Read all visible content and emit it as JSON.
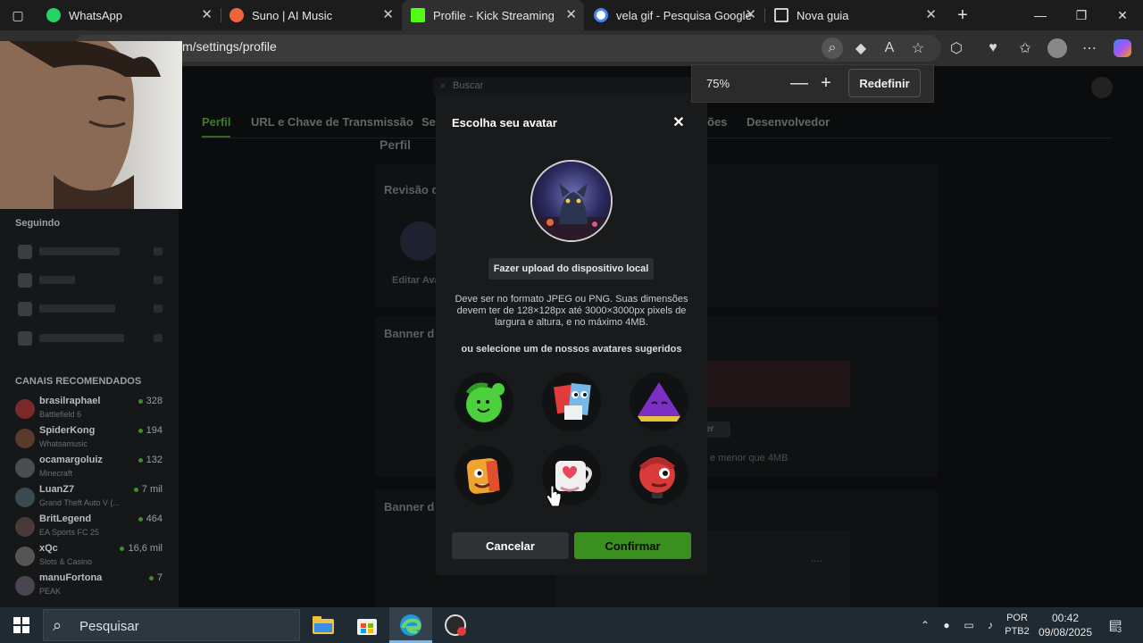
{
  "tabs": [
    {
      "title": "WhatsApp",
      "favicon": "whatsapp-icon",
      "color": "#25d366"
    },
    {
      "title": "Suno | AI Music",
      "favicon": "suno-icon",
      "color": "#f0643c"
    },
    {
      "title": "Profile - Kick Streaming",
      "favicon": "kick-icon",
      "color": "#53fc18",
      "active": true
    },
    {
      "title": "vela gif - Pesquisa Google",
      "favicon": "google-icon",
      "color": "#4285f4"
    },
    {
      "title": "Nova guia",
      "favicon": "new-tab-icon",
      "color": "#cccccc"
    }
  ],
  "address_bar": {
    "url": "m/settings/profile"
  },
  "zoom": {
    "value": "75%",
    "reset_label": "Redefinir"
  },
  "page": {
    "search_placeholder": "Buscar",
    "nav_tabs": [
      "Perfil",
      "URL e Chave de Transmissão",
      "Se",
      "ões",
      "Desenvolvedor"
    ],
    "section_title": "Perfil",
    "revision_label": "Revisão d",
    "edit_label": "Editar Ava",
    "banner_label_1": "Banner d",
    "banner_label_2": "Banner d",
    "banner_hint": "e menor que 4MB",
    "banner_btn": "er"
  },
  "sidebar": {
    "following_header": "Seguindo",
    "recommended_header": "CANAIS RECOMENDADOS",
    "recommended": [
      {
        "name": "brasilraphael",
        "game": "Battlefield 6",
        "viewers": "328"
      },
      {
        "name": "SpiderKong",
        "game": "Whatsamusic",
        "viewers": "194"
      },
      {
        "name": "ocamargoluiz",
        "game": "Minecraft",
        "viewers": "132"
      },
      {
        "name": "LuanZ7",
        "game": "Grand Theft Auto V (...",
        "viewers": "7 mil"
      },
      {
        "name": "BritLegend",
        "game": "EA Sports FC 25",
        "viewers": "464"
      },
      {
        "name": "xQc",
        "game": "Slots & Casino",
        "viewers": "16,6 mil"
      },
      {
        "name": "manuFortona",
        "game": "PEAK",
        "viewers": "7"
      }
    ]
  },
  "modal": {
    "title": "Escolha seu avatar",
    "upload_label": "Fazer upload do dispositivo local",
    "hint": "Deve ser no formato JPEG ou PNG. Suas dimensões devem ter de 128×128px até 3000×3000px pixels de largura e altura, e no máximo 4MB.",
    "suggest_label": "ou selecione um de nossos avatares sugeridos",
    "avatars": [
      "green-blob-avatar",
      "blue-red-block-avatar",
      "purple-triangle-avatar",
      "orange-face-avatar",
      "heart-mug-avatar",
      "red-ball-avatar"
    ],
    "cancel_label": "Cancelar",
    "confirm_label": "Confirmar"
  },
  "taskbar": {
    "search_placeholder": "Pesquisar",
    "lang": "POR",
    "layout": "PTB2",
    "time": "00:42",
    "date": "09/08/2025",
    "notifications": "3"
  }
}
